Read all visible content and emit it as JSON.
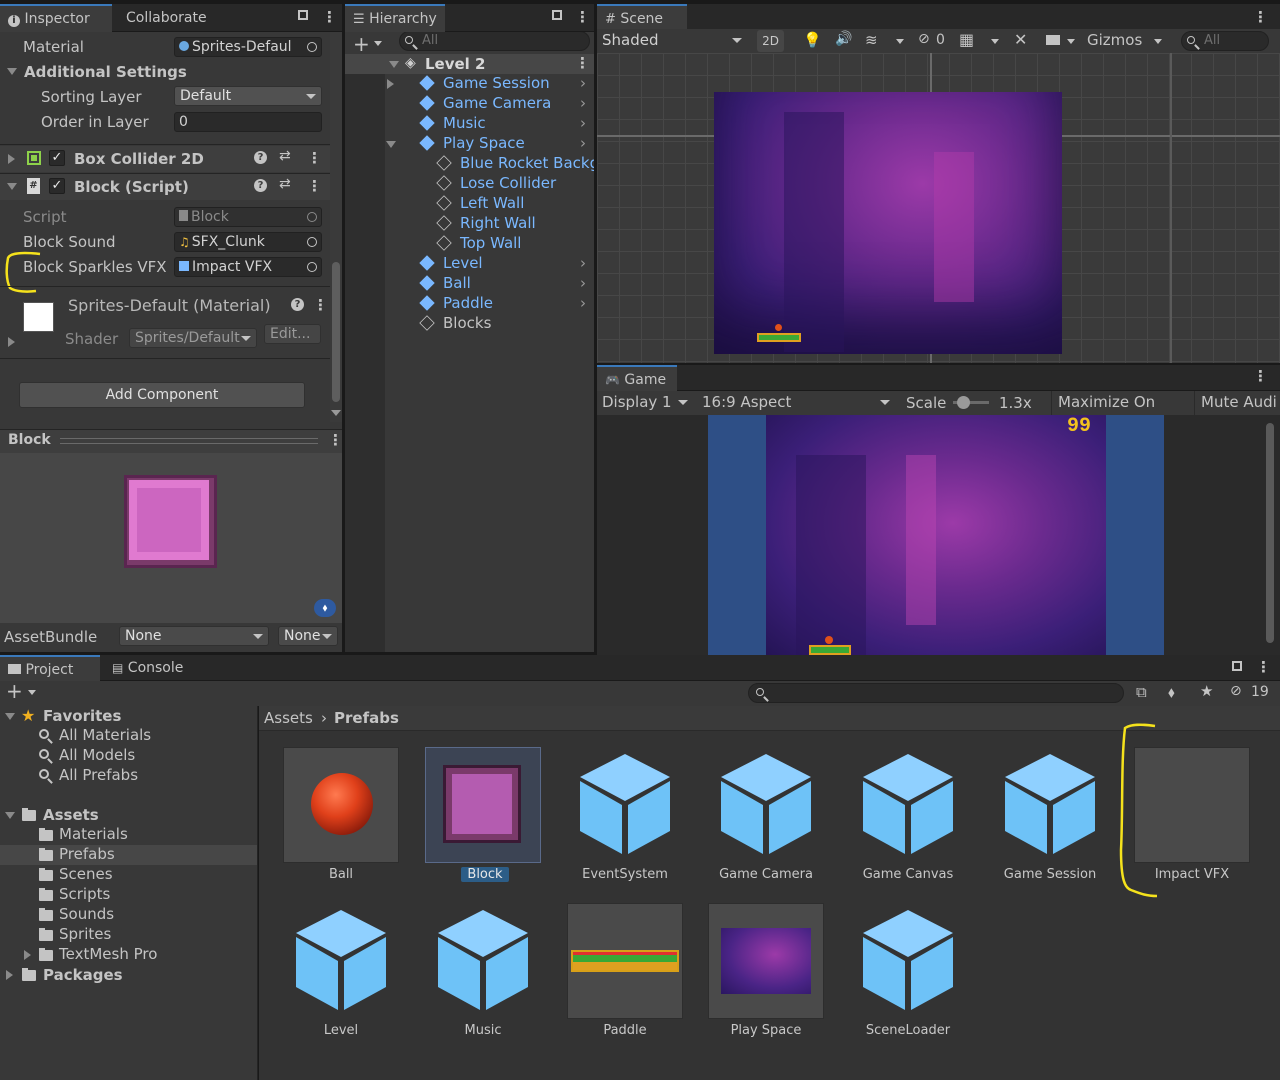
{
  "inspector": {
    "tab_inspector": "Inspector",
    "tab_collaborate": "Collaborate",
    "material_label": "Material",
    "material_value": "Sprites-Defaul",
    "additional_settings": "Additional Settings",
    "sorting_layer_label": "Sorting Layer",
    "sorting_layer_value": "Default",
    "order_label": "Order in Layer",
    "order_value": "0",
    "box_collider": "Box Collider 2D",
    "block_script": "Block (Script)",
    "script_label": "Script",
    "script_value": "Block",
    "block_sound_label": "Block Sound",
    "block_sound_value": "SFX_Clunk",
    "sparkles_label": "Block Sparkles VFX",
    "sparkles_value": "Impact VFX",
    "material_title": "Sprites-Default (Material)",
    "shader_label": "Shader",
    "shader_value": "Sprites/Default",
    "edit_button": "Edit...",
    "add_component": "Add Component",
    "preview_title": "Block",
    "assetbundle_label": "AssetBundle",
    "assetbundle_value": "None",
    "assetbundle_variant": "None"
  },
  "hierarchy": {
    "tab": "Hierarchy",
    "search_placeholder": "All",
    "scene": "Level 2",
    "items": [
      {
        "label": "Game Session",
        "indent": 1,
        "prefab": true,
        "arrow": "right",
        "chevron": true
      },
      {
        "label": "Game Camera",
        "indent": 1,
        "prefab": true,
        "arrow": "none",
        "chevron": true
      },
      {
        "label": "Music",
        "indent": 1,
        "prefab": true,
        "arrow": "none",
        "chevron": true
      },
      {
        "label": "Play Space",
        "indent": 1,
        "prefab": true,
        "arrow": "down",
        "chevron": true
      },
      {
        "label": "Blue Rocket Backg",
        "indent": 2,
        "prefab": false,
        "arrow": "none",
        "chevron": false
      },
      {
        "label": "Lose Collider",
        "indent": 2,
        "prefab": false,
        "arrow": "none",
        "chevron": false
      },
      {
        "label": "Left Wall",
        "indent": 2,
        "prefab": false,
        "arrow": "none",
        "chevron": false
      },
      {
        "label": "Right Wall",
        "indent": 2,
        "prefab": false,
        "arrow": "none",
        "chevron": false
      },
      {
        "label": "Top Wall",
        "indent": 2,
        "prefab": false,
        "arrow": "none",
        "chevron": false
      },
      {
        "label": "Level",
        "indent": 1,
        "prefab": true,
        "arrow": "none",
        "chevron": true
      },
      {
        "label": "Ball",
        "indent": 1,
        "prefab": true,
        "arrow": "none",
        "chevron": true
      },
      {
        "label": "Paddle",
        "indent": 1,
        "prefab": true,
        "arrow": "none",
        "chevron": true
      },
      {
        "label": "Blocks",
        "indent": 1,
        "prefab": false,
        "arrow": "none",
        "chevron": false
      }
    ]
  },
  "scene": {
    "tab": "Scene",
    "shading": "Shaded",
    "mode_2d": "2D",
    "hidden_count": "0",
    "gizmos": "Gizmos",
    "search_placeholder": "All"
  },
  "game": {
    "tab": "Game",
    "display": "Display 1",
    "aspect": "16:9 Aspect",
    "scale_label": "Scale",
    "scale_value": "1.3x",
    "maximize": "Maximize On Play",
    "mute": "Mute Audi",
    "score": "99"
  },
  "project": {
    "tab_project": "Project",
    "tab_console": "Console",
    "hidden_count": "19",
    "favorites": "Favorites",
    "fav_items": [
      "All Materials",
      "All Models",
      "All Prefabs"
    ],
    "assets_root": "Assets",
    "folders": [
      "Materials",
      "Prefabs",
      "Scenes",
      "Scripts",
      "Sounds",
      "Sprites",
      "TextMesh Pro"
    ],
    "packages": "Packages",
    "breadcrumb_root": "Assets",
    "breadcrumb_current": "Prefabs",
    "assets": [
      "Ball",
      "Block",
      "EventSystem",
      "Game Camera",
      "Game Canvas",
      "Game Session",
      "Impact VFX",
      "Level",
      "Music",
      "Paddle",
      "Play Space",
      "SceneLoader"
    ]
  },
  "colors": {
    "selection": "#3a79bb",
    "prefab_blue": "#7ab8ff",
    "annotation": "#f5e21c",
    "score": "#f2c21e"
  }
}
